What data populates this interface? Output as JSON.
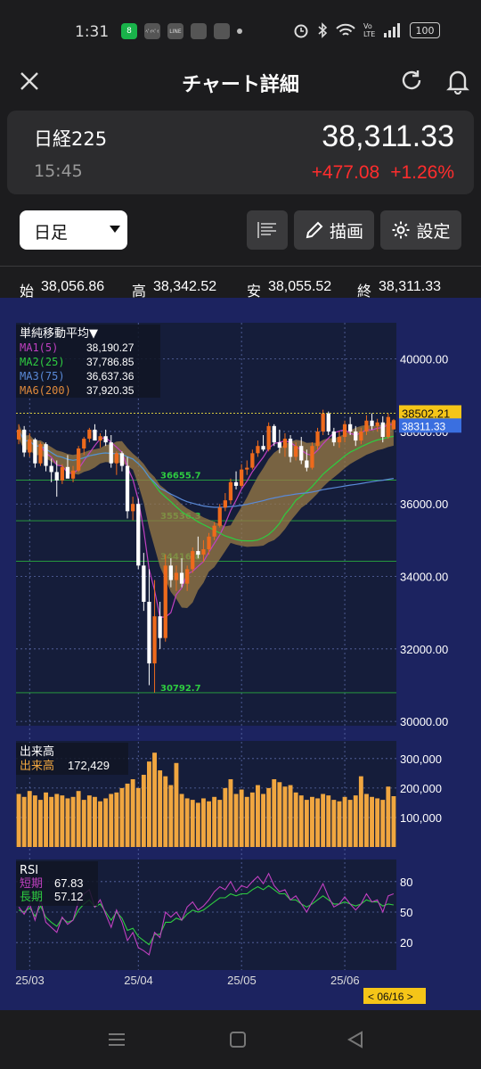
{
  "status": {
    "time": "1:31",
    "battery": "100",
    "left_icons": [
      "8",
      "ﾍﾟｲﾍﾟｲ",
      "LINE",
      "box",
      "pin"
    ],
    "right_label": "Vo LTE"
  },
  "header": {
    "title": "チャート詳細"
  },
  "quote": {
    "name": "日経225",
    "time": "15:45",
    "price": "38,311.33",
    "change": "+477.08",
    "change_pct": "+1.26%",
    "change_color": "#ff2d2d"
  },
  "controls": {
    "period": "日足",
    "draw_label": "描画",
    "settings_label": "設定"
  },
  "ohlc": {
    "open_label": "始",
    "open": "38,056.86",
    "high_label": "高",
    "high": "38,342.52",
    "low_label": "安",
    "low": "38,055.52",
    "close_label": "終",
    "close": "38,311.33"
  },
  "chart_data": {
    "type": "candlestick",
    "price_axis": {
      "ticks": [
        "40000.00",
        "38000.00",
        "36000.00",
        "34000.00",
        "32000.00",
        "30000.00"
      ],
      "values": [
        40000,
        38000,
        36000,
        34000,
        32000,
        30000
      ],
      "range": [
        29880,
        41000
      ]
    },
    "last_price_label": "38311.33",
    "cursor_price_label": "38502.21",
    "cursor_price": 38502.21,
    "x_labels": [
      "25/03",
      "25/04",
      "25/05",
      "25/06"
    ],
    "date_badge": "< 06/16 >",
    "ma_legend": {
      "title": "単純移動平均▼",
      "items": [
        {
          "label": "MA1(5)",
          "value": "38,190.27",
          "color": "#c040c0"
        },
        {
          "label": "MA2(25)",
          "value": "37,786.85",
          "color": "#2ecc40"
        },
        {
          "label": "MA3(75)",
          "value": "36,637.36",
          "color": "#5a8ad8"
        },
        {
          "label": "MA6(200)",
          "value": "37,920.35",
          "color": "#e08a3c"
        }
      ]
    },
    "level_lines": [
      {
        "label": "36655.7",
        "value": 36655.7
      },
      {
        "label": "35536.3",
        "value": 35536.3
      },
      {
        "label": "34416.8",
        "value": 34416.8
      },
      {
        "label": "30792.7",
        "value": 30792.7
      }
    ],
    "candles": [
      [
        37780,
        38200,
        37650,
        38050
      ],
      [
        38050,
        38150,
        37300,
        37420
      ],
      [
        37420,
        37950,
        37300,
        37780
      ],
      [
        37780,
        37820,
        37000,
        37120
      ],
      [
        37120,
        37700,
        37050,
        37650
      ],
      [
        37650,
        37700,
        36900,
        37050
      ],
      [
        37050,
        37250,
        36600,
        36880
      ],
      [
        36880,
        37200,
        36200,
        36650
      ],
      [
        36650,
        37100,
        36550,
        37020
      ],
      [
        37020,
        37350,
        36800,
        36700
      ],
      [
        36700,
        37050,
        36600,
        36920
      ],
      [
        36920,
        37600,
        36880,
        37530
      ],
      [
        37530,
        37850,
        37350,
        37800
      ],
      [
        37800,
        38100,
        37700,
        38050
      ],
      [
        38050,
        38200,
        37900,
        37750
      ],
      [
        37750,
        37950,
        37550,
        37870
      ],
      [
        37870,
        38050,
        37600,
        37700
      ],
      [
        37700,
        37900,
        37000,
        37120
      ],
      [
        37120,
        37450,
        36800,
        37400
      ],
      [
        37400,
        37450,
        36900,
        37050
      ],
      [
        37050,
        37300,
        35600,
        35800
      ],
      [
        35800,
        36200,
        35550,
        36000
      ],
      [
        36000,
        36150,
        34200,
        34300
      ],
      [
        34300,
        34650,
        33050,
        33300
      ],
      [
        33300,
        34200,
        31000,
        31600
      ],
      [
        31600,
        33900,
        30792,
        32900
      ],
      [
        32900,
        33300,
        32000,
        32300
      ],
      [
        32300,
        34600,
        32200,
        34300
      ],
      [
        34300,
        34500,
        33700,
        33900
      ],
      [
        33900,
        34300,
        33600,
        34100
      ],
      [
        34100,
        34500,
        33700,
        33800
      ],
      [
        33800,
        34300,
        33600,
        34200
      ],
      [
        34200,
        34800,
        34100,
        34700
      ],
      [
        34700,
        35100,
        34500,
        34600
      ],
      [
        34600,
        35000,
        34400,
        34750
      ],
      [
        34750,
        35200,
        34600,
        35100
      ],
      [
        35100,
        35500,
        35000,
        35400
      ],
      [
        35400,
        36000,
        35350,
        35900
      ],
      [
        35900,
        36300,
        35800,
        36100
      ],
      [
        36100,
        36700,
        36000,
        36600
      ],
      [
        36600,
        36900,
        36400,
        36500
      ],
      [
        36500,
        37100,
        36450,
        36950
      ],
      [
        36950,
        37200,
        36800,
        37000
      ],
      [
        37000,
        37500,
        36950,
        37400
      ],
      [
        37400,
        37750,
        37300,
        37600
      ],
      [
        37600,
        37900,
        37450,
        37500
      ],
      [
        37500,
        38250,
        37450,
        38150
      ],
      [
        38150,
        38200,
        37600,
        37700
      ],
      [
        37700,
        38050,
        37400,
        37550
      ],
      [
        37550,
        37950,
        37300,
        37800
      ],
      [
        37800,
        37900,
        37150,
        37300
      ],
      [
        37300,
        37700,
        37200,
        37600
      ],
      [
        37600,
        37850,
        37100,
        37200
      ],
      [
        37200,
        37500,
        36900,
        37000
      ],
      [
        37000,
        37700,
        36950,
        37600
      ],
      [
        37600,
        38100,
        37500,
        38000
      ],
      [
        38000,
        38600,
        37900,
        38500
      ],
      [
        38500,
        38550,
        37900,
        38000
      ],
      [
        38000,
        38100,
        37600,
        37700
      ],
      [
        37700,
        38000,
        37550,
        37850
      ],
      [
        37850,
        38300,
        37700,
        38200
      ],
      [
        38200,
        38400,
        37900,
        38000
      ],
      [
        38000,
        38150,
        37600,
        37750
      ],
      [
        37750,
        38100,
        37650,
        38000
      ],
      [
        38000,
        38450,
        37900,
        38300
      ],
      [
        38300,
        38500,
        38050,
        38150
      ],
      [
        38150,
        38350,
        38000,
        38250
      ],
      [
        38250,
        38420,
        37700,
        37850
      ],
      [
        37850,
        38500,
        37800,
        38400
      ],
      [
        38056.86,
        38342.52,
        38055.52,
        38311.33
      ]
    ],
    "volume": {
      "axis_ticks": [
        "300,000",
        "200,000",
        "100,000"
      ],
      "axis_values": [
        300000,
        200000,
        100000
      ],
      "legend_title": "出来高",
      "legend_label": "出来高",
      "legend_value": "172,429",
      "bar_color": "#f0a640",
      "values": [
        180000,
        170000,
        190000,
        175000,
        160000,
        185000,
        170000,
        180000,
        175000,
        165000,
        170000,
        190000,
        160000,
        175000,
        170000,
        155000,
        165000,
        180000,
        185000,
        200000,
        215000,
        230000,
        200000,
        245000,
        290000,
        320000,
        260000,
        240000,
        210000,
        285000,
        180000,
        165000,
        160000,
        150000,
        165000,
        155000,
        170000,
        160000,
        200000,
        230000,
        180000,
        195000,
        170000,
        185000,
        210000,
        180000,
        200000,
        230000,
        220000,
        205000,
        210000,
        185000,
        175000,
        160000,
        170000,
        165000,
        180000,
        175000,
        160000,
        155000,
        170000,
        160000,
        175000,
        240000,
        180000,
        170000,
        165000,
        160000,
        205000,
        172429
      ]
    },
    "rsi": {
      "axis_ticks": [
        "80",
        "50",
        "20"
      ],
      "axis_values": [
        80,
        50,
        20
      ],
      "legend_title": "RSI",
      "short_label": "短期",
      "short_value": "67.83",
      "short_color": "#c040c0",
      "long_label": "長期",
      "long_value": "57.12",
      "long_color": "#2ecc40",
      "short": [
        55,
        48,
        58,
        42,
        62,
        40,
        35,
        30,
        45,
        38,
        42,
        60,
        68,
        72,
        55,
        62,
        48,
        35,
        52,
        40,
        22,
        30,
        15,
        12,
        8,
        30,
        25,
        50,
        45,
        50,
        42,
        55,
        60,
        52,
        56,
        62,
        70,
        75,
        72,
        80,
        70,
        76,
        74,
        80,
        85,
        78,
        88,
        76,
        70,
        72,
        62,
        66,
        58,
        50,
        60,
        68,
        78,
        65,
        55,
        58,
        65,
        58,
        52,
        58,
        68,
        60,
        62,
        50,
        66,
        68
      ],
      "long": [
        52,
        50,
        54,
        46,
        56,
        45,
        40,
        36,
        44,
        40,
        42,
        52,
        58,
        62,
        55,
        58,
        50,
        42,
        50,
        44,
        32,
        34,
        26,
        22,
        18,
        28,
        28,
        40,
        40,
        44,
        42,
        48,
        52,
        50,
        52,
        56,
        60,
        64,
        64,
        68,
        66,
        68,
        68,
        72,
        75,
        72,
        76,
        72,
        68,
        68,
        62,
        62,
        58,
        55,
        58,
        62,
        66,
        62,
        58,
        58,
        60,
        58,
        56,
        58,
        62,
        60,
        60,
        56,
        58,
        57
      ]
    }
  }
}
